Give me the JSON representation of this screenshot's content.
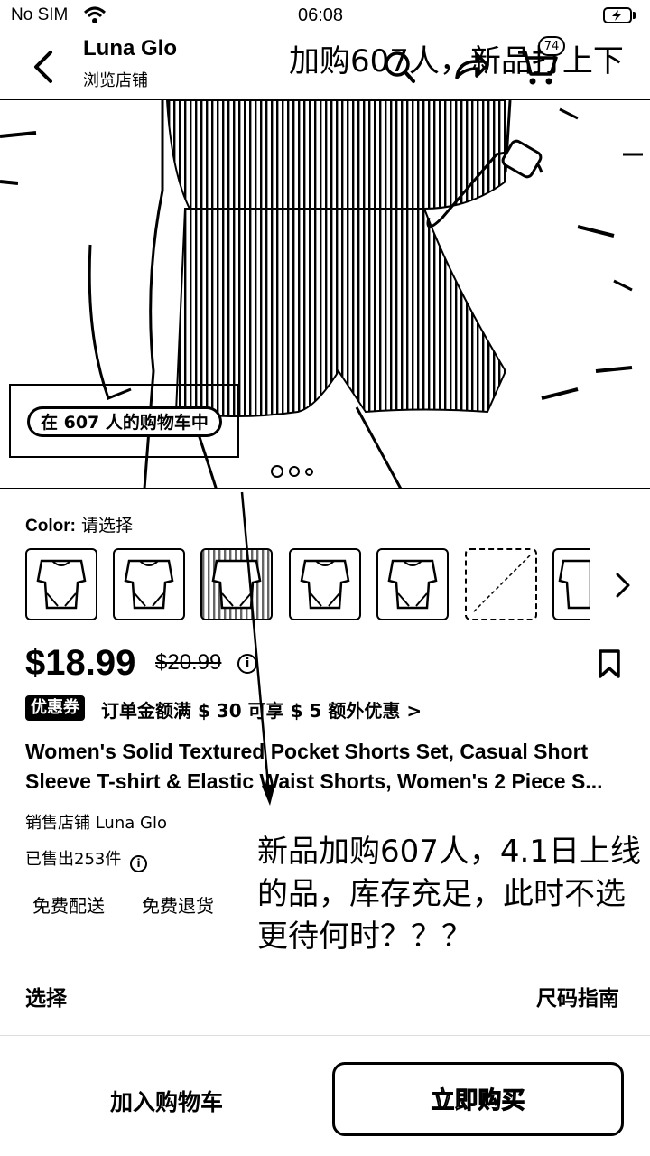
{
  "status_bar": {
    "carrier": "No SIM",
    "time": "06:08"
  },
  "header": {
    "store_name": "Luna Glo",
    "store_sub": "浏览店铺",
    "overlay_title": "加购607人，新品打上下",
    "cart_badge": "74"
  },
  "hero": {
    "cart_pill": "在 607 人的购物车中",
    "slide_count": 3
  },
  "color": {
    "label": "Color:",
    "value": "请选择"
  },
  "price": {
    "current": "$18.99",
    "original": "$20.99",
    "info_glyph": "i"
  },
  "coupon": {
    "tag": "优惠券",
    "text": "订单金额满 $ 30 可享 $ 5 额外优惠 >"
  },
  "product": {
    "title_line1": "Women's Solid Textured Pocket Shorts Set, Casual Short",
    "title_line2": "Sleeve T-shirt & Elastic Waist Shorts, Women's 2 Piece S..."
  },
  "seller": "销售店铺 Luna Glo",
  "sold": "已售出253件",
  "chips": {
    "shipping": "免费配送",
    "returns": "免费退货"
  },
  "annotation": "新品加购607人，4.1日上线的品，库存充足，此时不选更待何时？？？",
  "select": {
    "label": "选择",
    "size_guide": "尺码指南"
  },
  "actions": {
    "add_to_cart": "加入购物车",
    "buy_now": "立即购买"
  },
  "icons": [
    "back-icon",
    "search-icon",
    "share-icon",
    "cart-icon",
    "info-icon",
    "bookmark-icon",
    "chevron-right-icon",
    "wifi-icon",
    "battery-icon"
  ]
}
